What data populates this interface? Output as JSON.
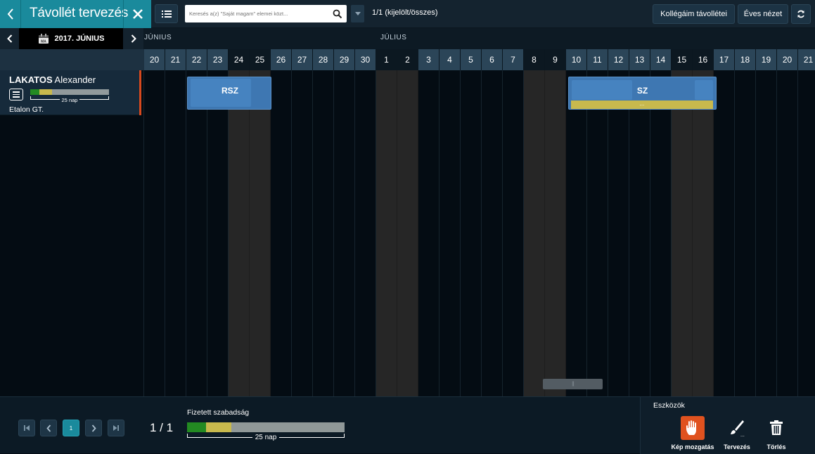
{
  "header": {
    "title": "Távollét tervezés",
    "search_placeholder": "Keresés a(z) \"Saját magam\" elemei közt...",
    "count_label": "1/1 (kijelölt/összes)",
    "colleagues_button": "Kollégáim távollétei",
    "yearly_button": "Éves nézet",
    "icons": [
      "chevron-left-icon",
      "close-icon",
      "list-icon",
      "search-icon",
      "caret-down-icon",
      "refresh-icon"
    ]
  },
  "nav": {
    "month_label": "2017. JÚNIUS",
    "calendar_icon_text": "MA",
    "month_names": {
      "june": "JÚNIUS",
      "july": "JÚLIUS"
    }
  },
  "days": [
    {
      "label": "20",
      "weekend": false
    },
    {
      "label": "21",
      "weekend": false
    },
    {
      "label": "22",
      "weekend": false
    },
    {
      "label": "23",
      "weekend": false
    },
    {
      "label": "24",
      "weekend": true
    },
    {
      "label": "25",
      "weekend": true
    },
    {
      "label": "26",
      "weekend": false
    },
    {
      "label": "27",
      "weekend": false
    },
    {
      "label": "28",
      "weekend": false
    },
    {
      "label": "29",
      "weekend": false
    },
    {
      "label": "30",
      "weekend": false
    },
    {
      "label": "1",
      "weekend": true
    },
    {
      "label": "2",
      "weekend": true
    },
    {
      "label": "3",
      "weekend": false
    },
    {
      "label": "4",
      "weekend": false
    },
    {
      "label": "5",
      "weekend": false
    },
    {
      "label": "6",
      "weekend": false
    },
    {
      "label": "7",
      "weekend": false
    },
    {
      "label": "8",
      "weekend": true
    },
    {
      "label": "9",
      "weekend": true
    },
    {
      "label": "10",
      "weekend": false
    },
    {
      "label": "11",
      "weekend": false
    },
    {
      "label": "12",
      "weekend": false
    },
    {
      "label": "13",
      "weekend": false
    },
    {
      "label": "14",
      "weekend": false
    },
    {
      "label": "15",
      "weekend": true
    },
    {
      "label": "16",
      "weekend": true
    },
    {
      "label": "17",
      "weekend": false
    },
    {
      "label": "18",
      "weekend": false
    },
    {
      "label": "19",
      "weekend": false
    },
    {
      "label": "20",
      "weekend": false
    },
    {
      "label": "21",
      "weekend": false
    }
  ],
  "employee": {
    "last_name": "LAKATOS",
    "first_name": "Alexander",
    "company": "Etalon GT.",
    "days_label": "25 nap",
    "used_fraction": 0.12,
    "planned_fraction": 0.16
  },
  "absences": [
    {
      "label": "RSZ",
      "start": "2017-06-22",
      "end": "2017-06-25"
    },
    {
      "label": "SZ",
      "start": "2017-07-10",
      "end": "2017-07-16",
      "bar_text": "..."
    }
  ],
  "footer": {
    "page_button": "1",
    "page_info": "1 / 1",
    "paid_leave_label": "Fizetett szabadság",
    "paid_days_label": "25 nap",
    "used_fraction": 0.12,
    "planned_fraction": 0.16,
    "tools_label": "Eszközök",
    "tools": {
      "move": "Kép mozgatás",
      "plan": "Tervezés",
      "delete": "Törlés"
    },
    "scrollbar_text": "|||"
  },
  "colors": {
    "accent": "#1a8a9c",
    "absence": "#3e77b2",
    "used": "#238a22",
    "planned": "#c8b94d",
    "remaining": "#929a9c",
    "tool_active": "#e0521f",
    "employee_marker": "#d7491e"
  }
}
